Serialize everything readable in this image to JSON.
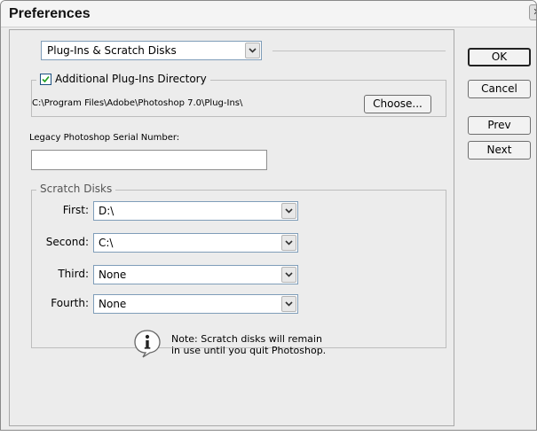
{
  "dialog": {
    "title": "Preferences"
  },
  "section_selector": {
    "selected": "Plug-Ins & Scratch Disks"
  },
  "plugins": {
    "checkbox_label": "Additional Plug-Ins Directory",
    "checked": true,
    "path": "C:\\Program Files\\Adobe\\Photoshop 7.0\\Plug-Ins\\",
    "choose_label": "Choose..."
  },
  "legacy": {
    "label": "Legacy Photoshop Serial Number:",
    "value": ""
  },
  "scratch": {
    "legend": "Scratch Disks",
    "rows": [
      {
        "label": "First:",
        "value": "D:\\"
      },
      {
        "label": "Second:",
        "value": "C:\\"
      },
      {
        "label": "Third:",
        "value": "None"
      },
      {
        "label": "Fourth:",
        "value": "None"
      }
    ]
  },
  "note": {
    "line1": "Note: Scratch disks will remain",
    "line2": "in use until you quit Photoshop."
  },
  "buttons": {
    "ok": "OK",
    "cancel": "Cancel",
    "prev": "Prev",
    "next": "Next"
  }
}
